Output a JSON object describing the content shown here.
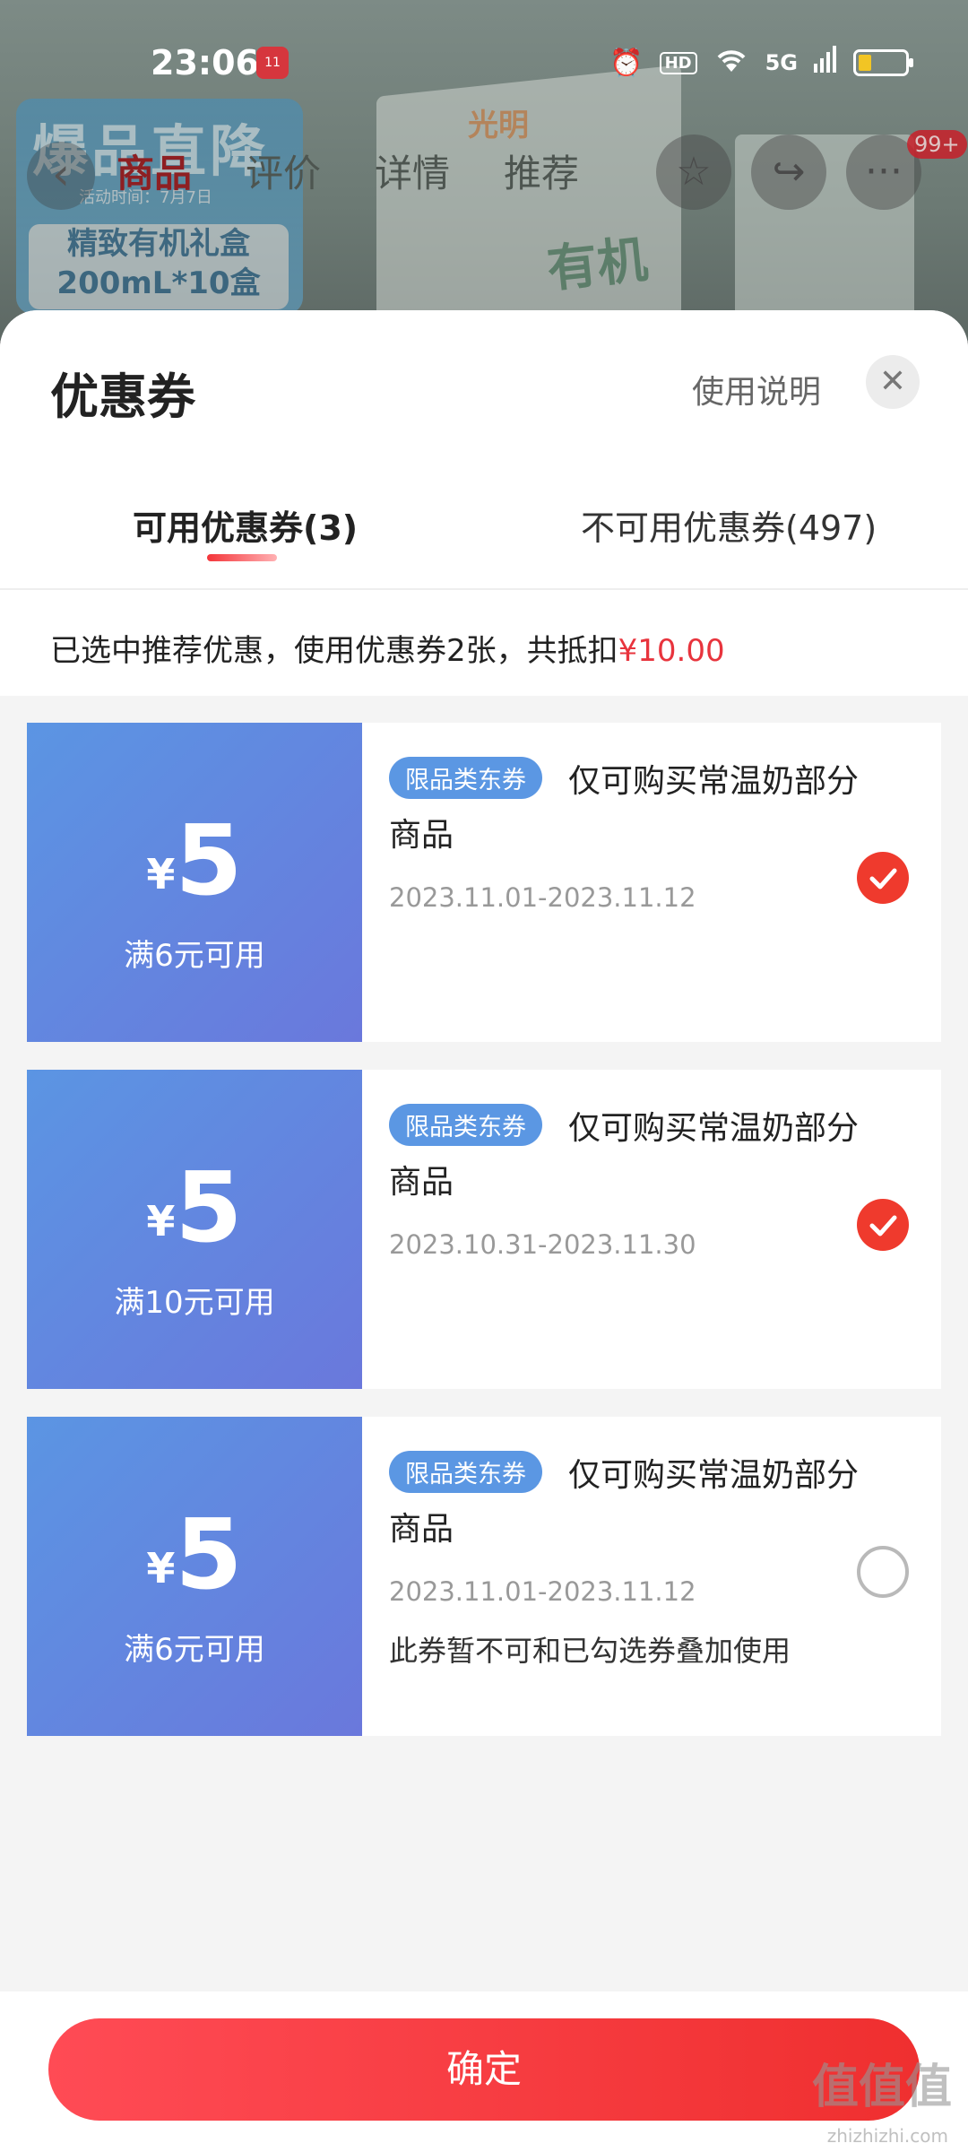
{
  "status_bar": {
    "time": "23:06",
    "hd_label": "HD",
    "signal_label": "5G"
  },
  "background_page": {
    "banner_title": "爆品直降",
    "banner_subtitle": "活动时间：7月7日",
    "banner_product_line1": "精致有机礼盒",
    "banner_product_line2": "200mL*10盒",
    "brand": "光明",
    "product_word": "有机",
    "nav_tabs": [
      "商品",
      "评价",
      "详情",
      "推荐"
    ],
    "more_badge": "99+"
  },
  "sheet": {
    "title": "优惠券",
    "help_link": "使用说明",
    "close_glyph": "✕",
    "tabs": [
      {
        "label": "可用优惠券(3)",
        "active": true
      },
      {
        "label": "不可用优惠券(497)",
        "active": false
      }
    ],
    "summary_text": "已选中推荐优惠，使用优惠券2张，共抵扣",
    "summary_amount": "¥10.00",
    "summary_amount_color": "#e8343d"
  },
  "coupons": [
    {
      "currency": "¥",
      "value": "5",
      "condition": "满6元可用",
      "tag": "限品类东券",
      "desc_line1": "仅可购买常温奶部分",
      "desc_line2": "商品",
      "date": "2023.11.01-2023.11.12",
      "note": "",
      "selected": true
    },
    {
      "currency": "¥",
      "value": "5",
      "condition": "满10元可用",
      "tag": "限品类东券",
      "desc_line1": "仅可购买常温奶部分",
      "desc_line2": "商品",
      "date": "2023.10.31-2023.11.30",
      "note": "",
      "selected": true
    },
    {
      "currency": "¥",
      "value": "5",
      "condition": "满6元可用",
      "tag": "限品类东券",
      "desc_line1": "仅可购买常温奶部分",
      "desc_line2": "商品",
      "date": "2023.11.01-2023.11.12",
      "note": "此券暂不可和已勾选券叠加使用",
      "selected": false
    }
  ],
  "footer": {
    "confirm_label": "确定"
  },
  "watermark": {
    "mark": "值值值",
    "url": "zhizhizhi.com"
  },
  "colors": {
    "accent": "#ef3a2d",
    "coupon_blue": "#5b95e3",
    "coupon_violet": "#6a78dc"
  }
}
